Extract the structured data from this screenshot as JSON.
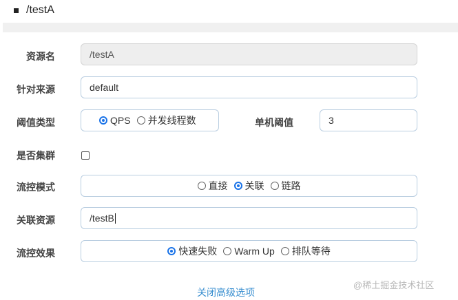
{
  "header": {
    "bullet_text": "/testA"
  },
  "form": {
    "resource_name": {
      "label": "资源名",
      "value": "/testA"
    },
    "limit_app": {
      "label": "针对来源",
      "value": "default"
    },
    "threshold_type": {
      "label": "阈值类型",
      "options": [
        "QPS",
        "并发线程数"
      ],
      "selected": "QPS"
    },
    "single_threshold": {
      "label": "单机阈值",
      "value": "3"
    },
    "cluster_mode": {
      "label": "是否集群",
      "checked": false
    },
    "flow_mode": {
      "label": "流控模式",
      "options": [
        "直接",
        "关联",
        "链路"
      ],
      "selected": "关联"
    },
    "ref_resource": {
      "label": "关联资源",
      "value": "/testB"
    },
    "control_behavior": {
      "label": "流控效果",
      "options": [
        "快速失败",
        "Warm Up",
        "排队等待"
      ],
      "selected": "快速失败"
    },
    "toggle_advanced_link": "关闭高级选项"
  },
  "watermark": "@稀土掘金技术社区",
  "colors": {
    "accent": "#1a73e8",
    "link": "#3a8fd0",
    "border": "#b8cde0",
    "readonly_bg": "#eeeeee"
  }
}
